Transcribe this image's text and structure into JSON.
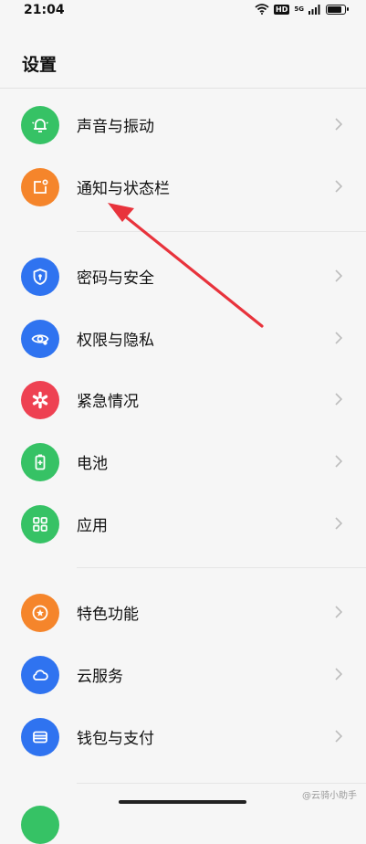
{
  "status_bar": {
    "time": "21:04",
    "hd_badge": "HD",
    "signal_label": "5G",
    "battery_percent": 85
  },
  "header": {
    "title": "设置"
  },
  "colors": {
    "green": "#36c265",
    "orange": "#f5852b",
    "blue": "#2f73f0",
    "red": "#ee4152"
  },
  "rows": [
    {
      "label": "声音与振动",
      "icon": "bell-icon"
    },
    {
      "label": "通知与状态栏",
      "icon": "notification-icon"
    },
    {
      "label": "密码与安全",
      "icon": "shield-icon"
    },
    {
      "label": "权限与隐私",
      "icon": "eye-icon"
    },
    {
      "label": "紧急情况",
      "icon": "asterisk-icon"
    },
    {
      "label": "电池",
      "icon": "battery-icon"
    },
    {
      "label": "应用",
      "icon": "apps-grid-icon"
    },
    {
      "label": "特色功能",
      "icon": "star-icon"
    },
    {
      "label": "云服务",
      "icon": "cloud-icon"
    },
    {
      "label": "钱包与支付",
      "icon": "wallet-icon"
    }
  ],
  "watermark": "@云骑小助手"
}
